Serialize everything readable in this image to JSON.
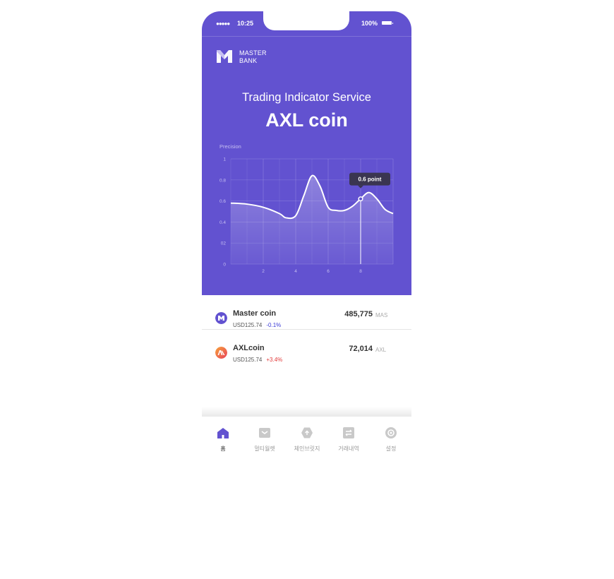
{
  "status_bar": {
    "signal": "●●●●●",
    "time": "10:25",
    "battery": "100%"
  },
  "brand": {
    "line1": "MASTER",
    "line2": "BANK"
  },
  "hero": {
    "title": "Trading Indicator Service",
    "coin": "AXL coin"
  },
  "chart_data": {
    "type": "line",
    "ylabel": "Precision",
    "ylim": [
      0,
      1
    ],
    "y_ticks": [
      "0",
      "02",
      "0.4",
      "0.6",
      "0.8",
      "1"
    ],
    "x_ticks": [
      "2",
      "4",
      "6",
      "8"
    ],
    "xlim": [
      0,
      10
    ],
    "series": [
      {
        "x": [
          0,
          1,
          2,
          3,
          3.4,
          4,
          4.5,
          5,
          5.5,
          6,
          6.5,
          7,
          7.5,
          8,
          8.5,
          9,
          9.5,
          10
        ],
        "y": [
          0.58,
          0.57,
          0.54,
          0.48,
          0.44,
          0.46,
          0.65,
          0.84,
          0.74,
          0.54,
          0.51,
          0.51,
          0.55,
          0.62,
          0.68,
          0.62,
          0.52,
          0.48
        ]
      }
    ],
    "marker": {
      "x": 8,
      "y": 0.62,
      "label": "0.6 point"
    },
    "grid": true
  },
  "coins": [
    {
      "name": "Master coin",
      "price": "USD125.74",
      "change": "-0.1%",
      "change_color": "#3a3ad6",
      "amount": "485,775",
      "unit": "MAS"
    },
    {
      "name": "AXLcoin",
      "price": "USD125.74",
      "change": "+3.4%",
      "change_color": "#e23b3b",
      "amount": "72,014",
      "unit": "AXL"
    }
  ],
  "tabs": [
    {
      "label": "홈",
      "icon": "home-icon"
    },
    {
      "label": "멀티월렛",
      "icon": "wallet-icon"
    },
    {
      "label": "체인브릿지",
      "icon": "chain-bridge-icon"
    },
    {
      "label": "거래내역",
      "icon": "transaction-icon"
    },
    {
      "label": "설정",
      "icon": "settings-icon"
    }
  ],
  "colors": {
    "accent": "#6252d0",
    "tooltip": "#3a3550"
  }
}
